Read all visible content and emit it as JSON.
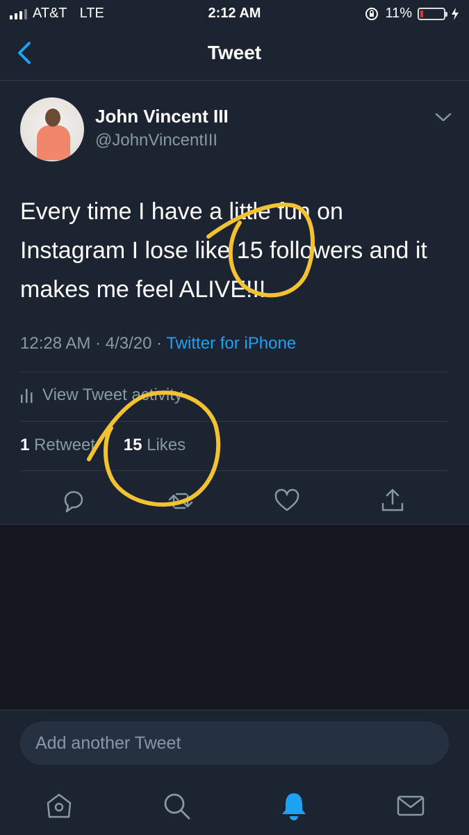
{
  "status_bar": {
    "carrier": "AT&T",
    "network": "LTE",
    "time": "2:12 AM",
    "battery_percent": "11%",
    "battery_level": 0.11,
    "battery_color": "#e0352b"
  },
  "nav": {
    "title": "Tweet",
    "back_icon": "chevron-left-icon"
  },
  "tweet": {
    "author_name": "John Vincent III",
    "author_handle": "@JohnVincentIII",
    "text": "Every time I have a little fun on Instagram I lose like 15 followers and it makes me feel ALIVE!!!",
    "time": "12:28 AM",
    "date": "4/3/20",
    "source": "Twitter for iPhone",
    "activity_label": "View Tweet activity",
    "retweets_count": "1",
    "retweets_label": "Retweet",
    "likes_count": "15",
    "likes_label": "Likes"
  },
  "composer": {
    "placeholder": "Add another Tweet"
  },
  "tabs": [
    {
      "name": "home",
      "icon": "home-icon"
    },
    {
      "name": "search",
      "icon": "search-icon"
    },
    {
      "name": "notifications",
      "icon": "bell-icon",
      "active": true
    },
    {
      "name": "messages",
      "icon": "mail-icon"
    }
  ],
  "colors": {
    "accent": "#1da1f2",
    "background": "#15181f",
    "card": "#1c2331",
    "secondary_text": "#8899a6",
    "annotation": "#f2c230"
  }
}
